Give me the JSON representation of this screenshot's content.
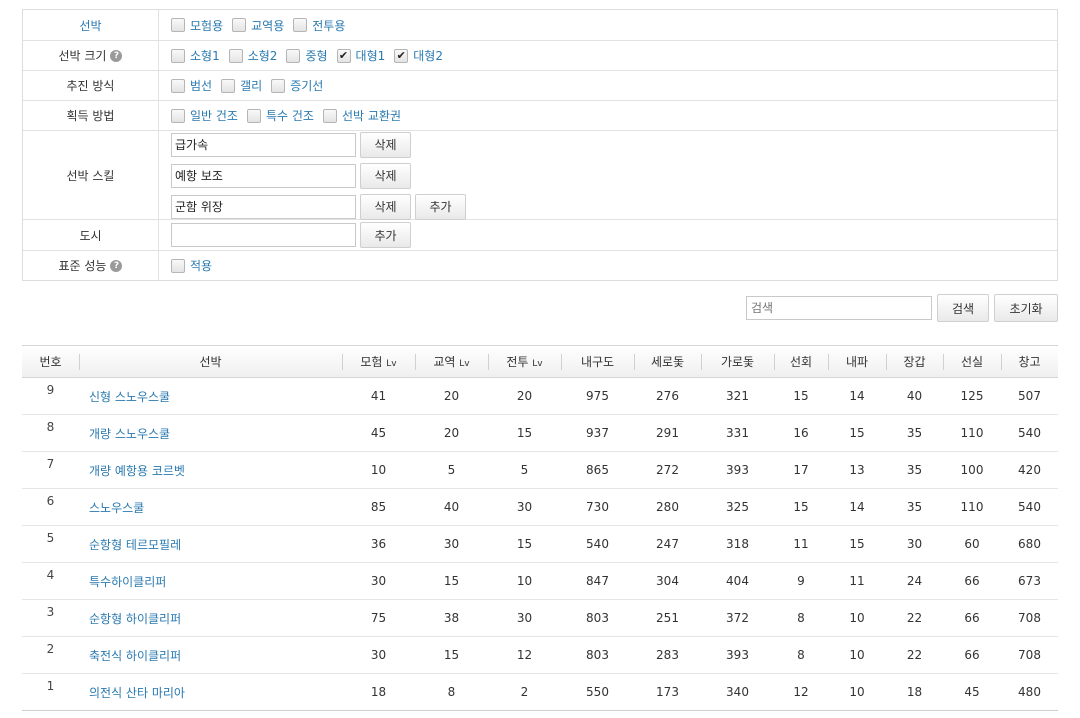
{
  "filters": {
    "ship_type": {
      "label": "선박",
      "options": [
        {
          "label": "모험용",
          "checked": false
        },
        {
          "label": "교역용",
          "checked": false
        },
        {
          "label": "전투용",
          "checked": false
        }
      ]
    },
    "ship_size": {
      "label": "선박 크기",
      "options": [
        {
          "label": "소형1",
          "checked": false
        },
        {
          "label": "소형2",
          "checked": false
        },
        {
          "label": "중형",
          "checked": false
        },
        {
          "label": "대형1",
          "checked": true
        },
        {
          "label": "대형2",
          "checked": true
        }
      ]
    },
    "propulsion": {
      "label": "추진 방식",
      "options": [
        {
          "label": "범선",
          "checked": false
        },
        {
          "label": "갤리",
          "checked": false
        },
        {
          "label": "증기선",
          "checked": false
        }
      ]
    },
    "acquire": {
      "label": "획득 방법",
      "options": [
        {
          "label": "일반 건조",
          "checked": false
        },
        {
          "label": "특수 건조",
          "checked": false
        },
        {
          "label": "선박 교환권",
          "checked": false
        }
      ]
    },
    "skills": {
      "label": "선박 스킬",
      "values": [
        "급가속",
        "예항 보조",
        "군함 위장"
      ],
      "delete_label": "삭제",
      "add_label": "추가"
    },
    "city": {
      "label": "도시",
      "value": "",
      "add_label": "추가"
    },
    "standard": {
      "label": "표준 성능",
      "option": {
        "label": "적용",
        "checked": false
      }
    },
    "help_glyph": "?",
    "check_glyph": "✔"
  },
  "search": {
    "placeholder": "검색",
    "search_label": "검색",
    "reset_label": "초기화"
  },
  "table": {
    "headers": {
      "no": "번호",
      "ship": "선박",
      "adv": "모험",
      "trade": "교역",
      "battle": "전투",
      "lv": "Lv",
      "durability": "내구도",
      "vsail": "세로돛",
      "hsail": "가로돛",
      "turn": "선회",
      "wave": "내파",
      "armor": "장갑",
      "cabin": "선실",
      "storage": "창고"
    },
    "rows": [
      {
        "no": "9",
        "name": "신형 스노우스쿨",
        "adv": "41",
        "trade": "20",
        "battle": "20",
        "durability": "975",
        "vsail": "276",
        "hsail": "321",
        "turn": "15",
        "wave": "14",
        "armor": "40",
        "cabin": "125",
        "storage": "507"
      },
      {
        "no": "8",
        "name": "개량 스노우스쿨",
        "adv": "45",
        "trade": "20",
        "battle": "15",
        "durability": "937",
        "vsail": "291",
        "hsail": "331",
        "turn": "16",
        "wave": "15",
        "armor": "35",
        "cabin": "110",
        "storage": "540"
      },
      {
        "no": "7",
        "name": "개량 예항용 코르벳",
        "adv": "10",
        "trade": "5",
        "battle": "5",
        "durability": "865",
        "vsail": "272",
        "hsail": "393",
        "turn": "17",
        "wave": "13",
        "armor": "35",
        "cabin": "100",
        "storage": "420"
      },
      {
        "no": "6",
        "name": "스노우스쿨",
        "adv": "85",
        "trade": "40",
        "battle": "30",
        "durability": "730",
        "vsail": "280",
        "hsail": "325",
        "turn": "15",
        "wave": "14",
        "armor": "35",
        "cabin": "110",
        "storage": "540"
      },
      {
        "no": "5",
        "name": "순항형 테르모필레",
        "adv": "36",
        "trade": "30",
        "battle": "15",
        "durability": "540",
        "vsail": "247",
        "hsail": "318",
        "turn": "11",
        "wave": "15",
        "armor": "30",
        "cabin": "60",
        "storage": "680"
      },
      {
        "no": "4",
        "name": "특수하이클리퍼",
        "adv": "30",
        "trade": "15",
        "battle": "10",
        "durability": "847",
        "vsail": "304",
        "hsail": "404",
        "turn": "9",
        "wave": "11",
        "armor": "24",
        "cabin": "66",
        "storage": "673"
      },
      {
        "no": "3",
        "name": "순항형 하이클리퍼",
        "adv": "75",
        "trade": "38",
        "battle": "30",
        "durability": "803",
        "vsail": "251",
        "hsail": "372",
        "turn": "8",
        "wave": "10",
        "armor": "22",
        "cabin": "66",
        "storage": "708"
      },
      {
        "no": "2",
        "name": "축전식 하이클리퍼",
        "adv": "30",
        "trade": "15",
        "battle": "12",
        "durability": "803",
        "vsail": "283",
        "hsail": "393",
        "turn": "8",
        "wave": "10",
        "armor": "22",
        "cabin": "66",
        "storage": "708"
      },
      {
        "no": "1",
        "name": "의전식 산타 마리아",
        "adv": "18",
        "trade": "8",
        "battle": "2",
        "durability": "550",
        "vsail": "173",
        "hsail": "340",
        "turn": "12",
        "wave": "10",
        "armor": "18",
        "cabin": "45",
        "storage": "480"
      }
    ]
  }
}
